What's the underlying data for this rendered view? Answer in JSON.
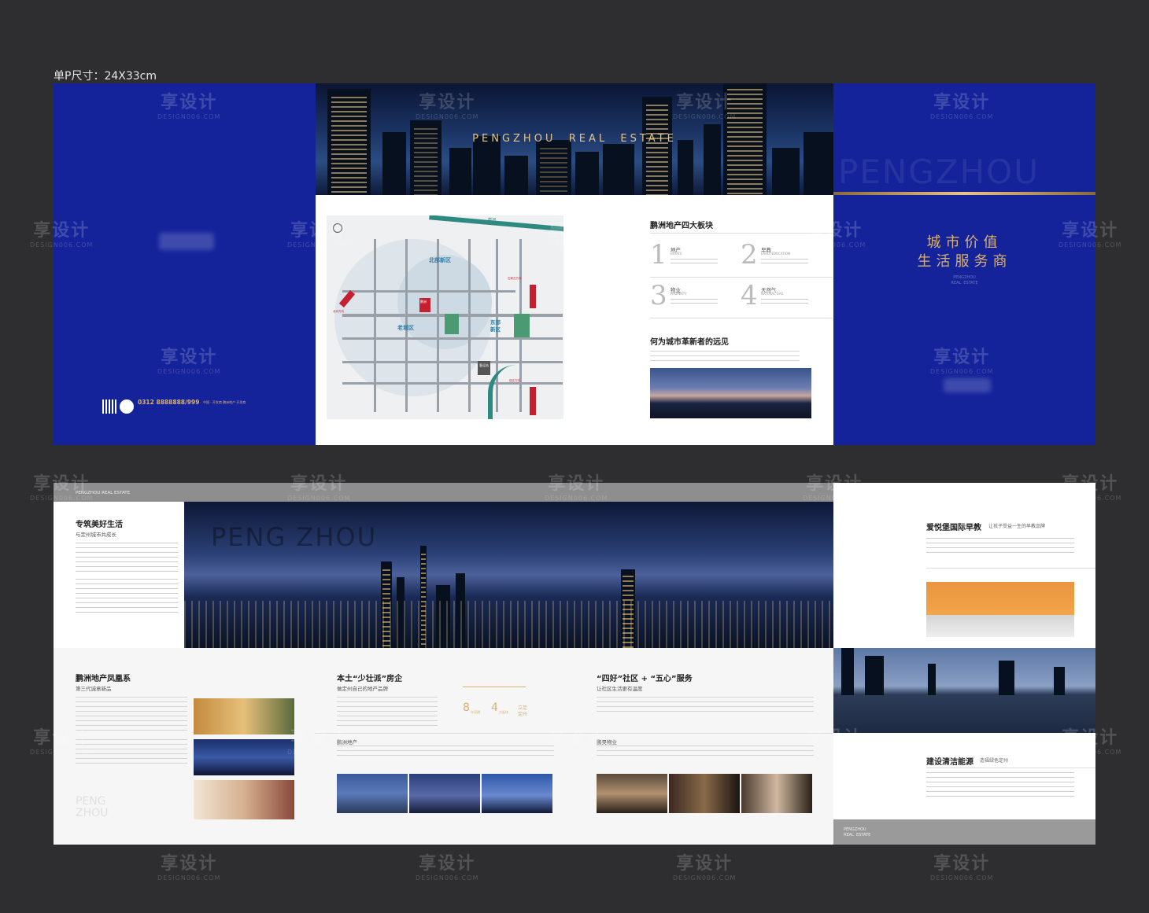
{
  "size_label": "单P尺寸：24X33cm",
  "watermark": {
    "cn": "享设计",
    "en": "DESIGN006.COM"
  },
  "top": {
    "banner_title": "PENGZHOU  REAL  ESTATE",
    "cover_big": "PENGZHOU",
    "cover_slogan_1": "城市价值",
    "cover_slogan_2": "生活服务商",
    "cover_small": "PENGZHOU\nREAL  ESTATE",
    "back_phone": "0312 8888888/999",
    "back_phone_note": "中国 · 开发商  鹏洲地产·开发商",
    "map": {
      "north_district": "北部新区",
      "old_district": "老城区",
      "east_district": "东部新区",
      "river": "唐河",
      "project": "鹏洲",
      "station": "客运站",
      "exit_left": "北京方向",
      "exit_right_top": "石家庄方向",
      "exit_right_bottom": "保定方向"
    },
    "sectors_title": "鹏洲地产四大板块",
    "sectors": [
      {
        "num": "1",
        "cn": "地产",
        "en": "ESTATE"
      },
      {
        "num": "2",
        "cn": "早教",
        "en": "EARLY EDUCATION"
      },
      {
        "num": "3",
        "cn": "物业",
        "en": "PROPERTY"
      },
      {
        "num": "4",
        "cn": "天然气",
        "en": "NATURAL GAS"
      }
    ],
    "vision_title": "何为城市革新者的远见"
  },
  "bottom": {
    "header_small": "PENGZHOU REAL ESTATE",
    "left_title": "专筑美好生活",
    "left_sub": "与定州城市共成长",
    "pano_overlay": "PENG ZHOU",
    "phoenix_title": "鹏洲地产凤凰系",
    "phoenix_sub": "第三代诚意新品",
    "phoenix_watermark": "PENG\nZHOU",
    "local_title": "本土“少壮派”房企",
    "local_sub": "做定州自己的地产品牌",
    "stats": [
      {
        "value": "8",
        "unit": "年深耕"
      },
      {
        "value": "4",
        "unit": "大板块"
      },
      {
        "value": "立足",
        "unit": "定州"
      }
    ],
    "estate_label": "鹏洲地产",
    "community_title": "“四好”社区 + “五心”服务",
    "community_sub": "让社区生活更有温度",
    "property_label": "鹏昊物业",
    "early_title": "爱悦堡国际早教",
    "early_sub": "让孩子受益一生的早教品牌",
    "energy_title": "建设清洁能源",
    "energy_sub": "造福绿色定州",
    "footer_small": "PENGZHOU\nREAL  ESTATE"
  },
  "colors": {
    "navy": "#14239a",
    "gold": "#d9b070",
    "bg": "#2e2e30"
  }
}
